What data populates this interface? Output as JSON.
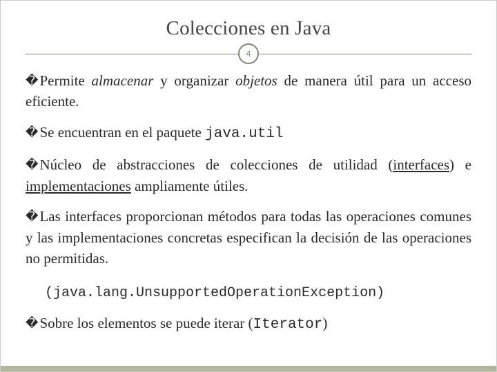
{
  "title": "Colecciones en Java",
  "page_number": "4",
  "bullets": {
    "b1": {
      "pre": "Permite ",
      "em1": "almacenar",
      "mid": " y organizar ",
      "em2": "objetos",
      "post": " de manera útil para un acceso eficiente."
    },
    "b2": {
      "pre": "Se encuentran en el paquete ",
      "code": "java.util"
    },
    "b3": {
      "pre": "Núcleo de abstracciones de colecciones de utilidad (",
      "u1": "interfaces",
      "mid": ") e ",
      "u2": "implementaciones",
      "post": " ampliamente útiles."
    },
    "b4": {
      "text": "Las interfaces proporcionan métodos para todas las operaciones comunes y las implementaciones concretas especifican la decisión de las operaciones no permitidas."
    },
    "exception": "(java.lang.UnsupportedOperationException)",
    "b5": {
      "pre": "Sobre los elementos se puede iterar (",
      "code": "Iterator",
      "post": ")"
    }
  },
  "marker": "�",
  "colors": {
    "accent": "#7b8a6a",
    "footer": "#b0b79c"
  }
}
